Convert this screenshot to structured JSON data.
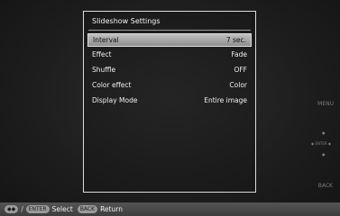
{
  "panel": {
    "title": "Slideshow Settings",
    "rows": [
      {
        "label": "Interval",
        "value": "7 sec."
      },
      {
        "label": "Effect",
        "value": "Fade"
      },
      {
        "label": "Shuffle",
        "value": "OFF"
      },
      {
        "label": "Color effect",
        "value": "Color"
      },
      {
        "label": "Display Mode",
        "value": "Entire image"
      }
    ]
  },
  "side": {
    "menu_label": "MENU",
    "enter_label": "ENTER",
    "back_label": "BACK"
  },
  "footer": {
    "arrows_key": "◆◆",
    "slash": "/",
    "enter_key": "ENTER",
    "select_label": "Select",
    "back_key": "BACK",
    "return_label": "Return"
  },
  "colors": {
    "selected_row": "#a8a8a8",
    "panel_border": "#dcdcdc",
    "footer_bg": "#4a4a4a"
  }
}
